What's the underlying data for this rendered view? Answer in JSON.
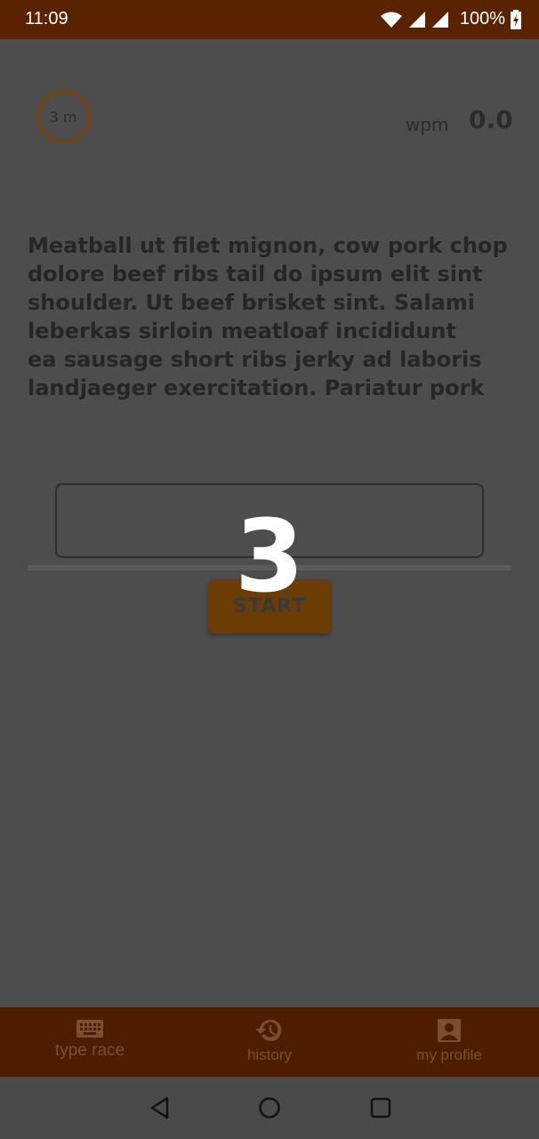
{
  "status_bar": {
    "time": "11:09",
    "battery": "100%"
  },
  "timer": {
    "label": "3 m"
  },
  "wpm": {
    "label": "wpm",
    "value": "0.0"
  },
  "passage": {
    "lines": [
      "Meatball ut filet mignon, cow pork chop",
      "dolore beef ribs tail do ipsum elit sint",
      "shoulder. Ut beef brisket sint. Salami",
      "leberkas sirloin meatloaf incididunt",
      "ea sausage short ribs jerky ad laboris",
      "landjaeger exercitation. Pariatur pork"
    ]
  },
  "input": {
    "value": "",
    "placeholder": ""
  },
  "start_button": {
    "label": "START"
  },
  "countdown": {
    "value": "3"
  },
  "bottom_nav": {
    "items": [
      {
        "label": "type race",
        "icon": "keyboard-icon"
      },
      {
        "label": "history",
        "icon": "history-icon"
      },
      {
        "label": "my profile",
        "icon": "account-box-icon"
      }
    ]
  },
  "colors": {
    "brand_dark": "#5a2300",
    "accent": "#6b3c04",
    "overlay": "#4d4d4d"
  }
}
